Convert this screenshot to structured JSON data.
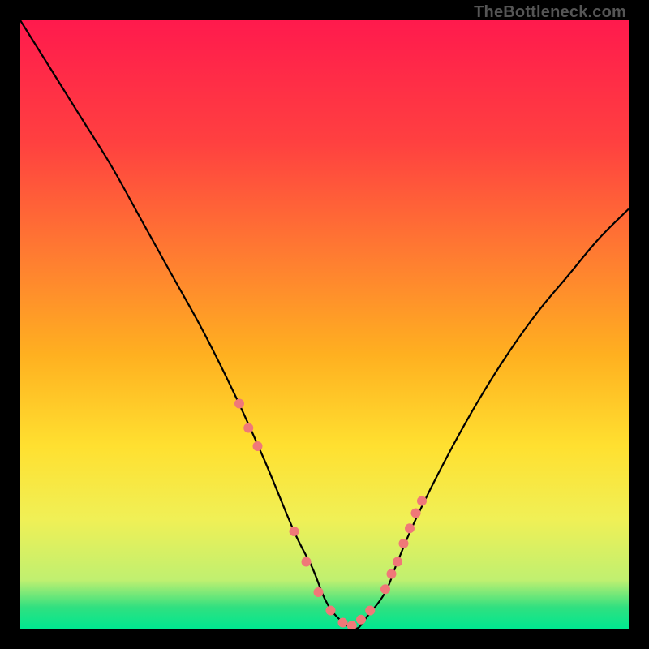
{
  "watermark": "TheBottleneck.com",
  "chart_data": {
    "type": "line",
    "title": "",
    "xlabel": "",
    "ylabel": "",
    "xlim": [
      0,
      100
    ],
    "ylim": [
      0,
      100
    ],
    "gradient_stops": [
      {
        "offset": 0.0,
        "color": "#ff1a4d"
      },
      {
        "offset": 0.2,
        "color": "#ff4040"
      },
      {
        "offset": 0.4,
        "color": "#ff8030"
      },
      {
        "offset": 0.55,
        "color": "#ffb020"
      },
      {
        "offset": 0.7,
        "color": "#ffe030"
      },
      {
        "offset": 0.82,
        "color": "#f0f056"
      },
      {
        "offset": 0.92,
        "color": "#c0f070"
      },
      {
        "offset": 0.965,
        "color": "#30e080"
      },
      {
        "offset": 1.0,
        "color": "#00e890"
      }
    ],
    "series": [
      {
        "name": "bottleneck-curve",
        "x": [
          0,
          5,
          10,
          15,
          20,
          25,
          30,
          35,
          40,
          45,
          48,
          50,
          52,
          55,
          57,
          60,
          62,
          65,
          70,
          75,
          80,
          85,
          90,
          95,
          100
        ],
        "y": [
          100,
          92,
          84,
          76,
          67,
          58,
          49,
          39,
          28,
          16,
          10,
          5,
          2,
          0,
          2,
          6,
          11,
          18,
          28,
          37,
          45,
          52,
          58,
          64,
          69
        ]
      }
    ],
    "markers": {
      "name": "highlight-dots",
      "color": "#f07878",
      "x": [
        36,
        37.5,
        39,
        45,
        47,
        49,
        51,
        53,
        54.5,
        56,
        57.5,
        60,
        61,
        62,
        63,
        64,
        65,
        66
      ],
      "y": [
        37,
        33,
        30,
        16,
        11,
        6,
        3,
        1,
        0.5,
        1.5,
        3,
        6.5,
        9,
        11,
        14,
        16.5,
        19,
        21
      ]
    }
  }
}
